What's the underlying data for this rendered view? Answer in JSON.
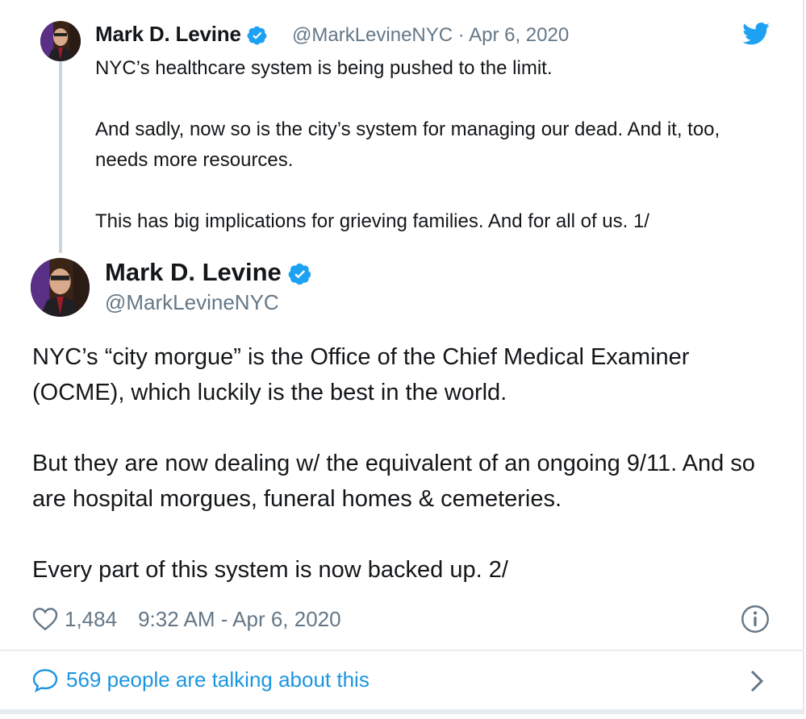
{
  "quoted_tweet": {
    "author_name": "Mark D. Levine",
    "handle": "@MarkLevineNYC",
    "separator": "·",
    "date": "Apr 6, 2020",
    "paragraphs": [
      "NYC’s healthcare system is being pushed to the limit.",
      "And sadly, now so is the city’s system for managing our dead. And it, too, needs more resources.",
      "This has big implications for grieving families. And for all of us.  1/"
    ]
  },
  "main_tweet": {
    "author_name": "Mark D. Levine",
    "handle": "@MarkLevineNYC",
    "paragraphs": [
      "NYC’s “city morgue” is the Office of the Chief Medical Examiner (OCME), which luckily is the best in the world.",
      "But they are now dealing w/ the equivalent of an ongoing 9/11. And so are hospital morgues, funeral homes & cemeteries.",
      "Every part of this system is now backed up. 2/"
    ],
    "likes": "1,484",
    "timestamp": "9:32 AM - Apr 6, 2020"
  },
  "conversation": {
    "label": "569 people are talking about this"
  },
  "icons": {
    "verified": "verified-badge-icon",
    "twitter": "twitter-bird-icon",
    "like": "heart-icon",
    "info": "info-icon",
    "reply": "speech-bubble-icon",
    "chevron": "chevron-right-icon"
  },
  "colors": {
    "accent": "#1da1f2",
    "link": "#1b95e0",
    "secondary_text": "#657786",
    "primary_text": "#14171a",
    "thread_line": "#ccd6dd"
  }
}
